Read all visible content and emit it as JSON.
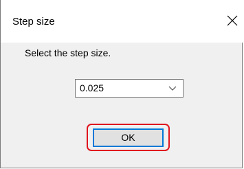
{
  "window": {
    "title": "Step size",
    "close_icon": "close-icon"
  },
  "content": {
    "prompt": "Select the step size.",
    "step_select": {
      "value": "0.025",
      "icon": "chevron-down-icon"
    }
  },
  "buttons": {
    "ok_label": "OK"
  },
  "colors": {
    "highlight": "#e0141e",
    "focus_border": "#0078d7",
    "button_bg": "#e1e1e1",
    "dialog_bg": "#f0f0f0"
  }
}
